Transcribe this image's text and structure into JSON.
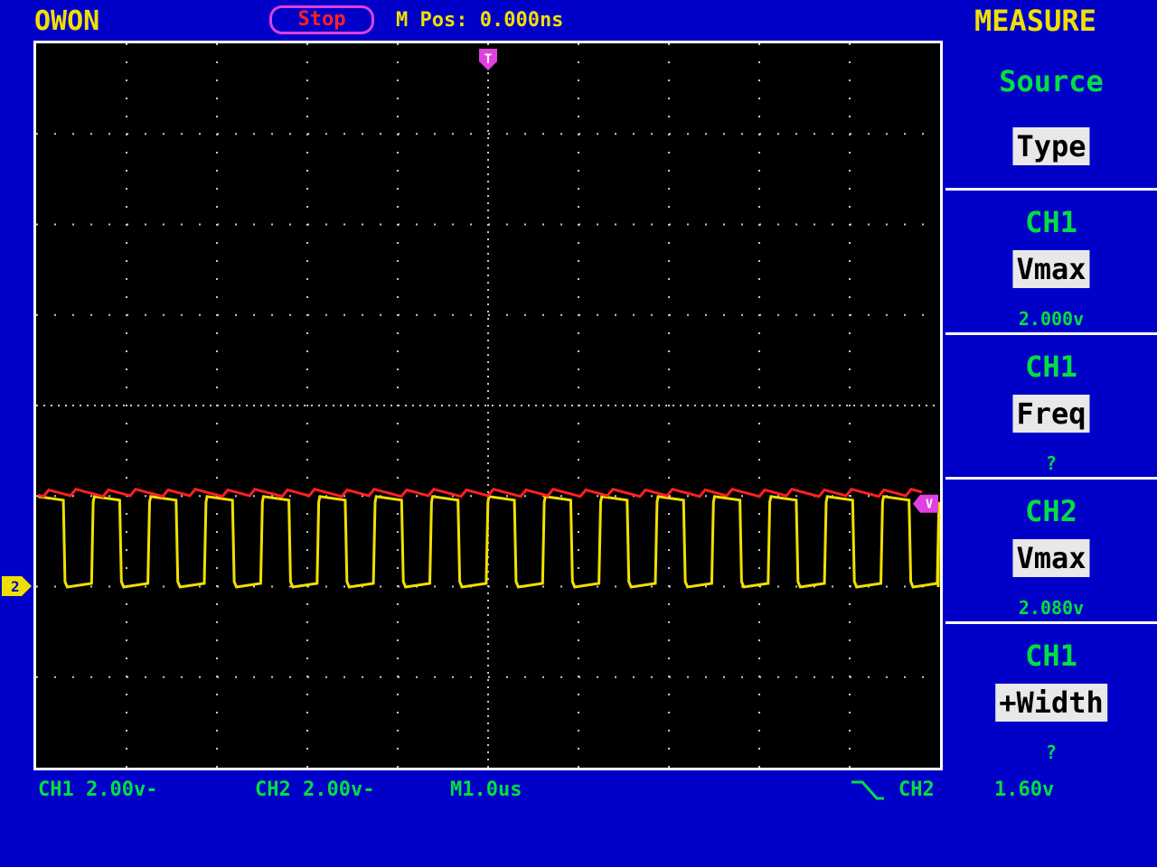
{
  "header": {
    "brand": "OWON",
    "run_state": "Stop",
    "m_pos": "M Pos: 0.000ns",
    "menu_title": "MEASURE"
  },
  "menu": {
    "source_label": "Source",
    "type_button": "Type",
    "items": [
      {
        "channel": "CH1",
        "type": "Vmax",
        "value": "2.000v"
      },
      {
        "channel": "CH1",
        "type": "Freq",
        "value": "?"
      },
      {
        "channel": "CH2",
        "type": "Vmax",
        "value": "2.080v"
      },
      {
        "channel": "CH1",
        "type": "+Width",
        "value": "?"
      }
    ]
  },
  "status": {
    "ch1": "CH1  2.00v-",
    "ch2": "CH2  2.00v-",
    "timebase": "M1.0us",
    "trigger_source": "CH2",
    "trigger_level": "1.60v"
  },
  "markers": {
    "trigger": "T",
    "level": "V",
    "channel": "2"
  },
  "colors": {
    "background": "#0000c8",
    "ch1_trace": "#f0e000",
    "ch2_trace": "#ff2020",
    "menu_text": "#00e040",
    "marker": "#e040e0"
  },
  "chart_data": {
    "type": "line",
    "series": [
      {
        "name": "CH1",
        "waveform": "square",
        "high": 2.0,
        "low": 0.0,
        "periods": 16
      },
      {
        "name": "CH2",
        "waveform": "flat",
        "level": 2.08
      }
    ]
  }
}
